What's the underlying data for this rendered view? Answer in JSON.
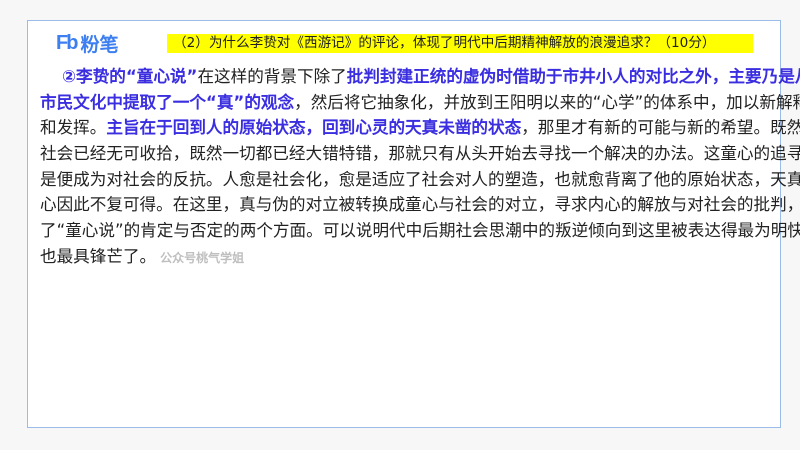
{
  "logo": {
    "mark": "Fb",
    "text": "粉笔"
  },
  "question": "（2）为什么李贽对《西游记》的评论，体现了明代中后期精神解放的浪漫追求？（10分）",
  "lines": [
    [
      {
        "t": "②李贽的“童心说”",
        "h": true
      },
      {
        "t": "在这样的背景下除了",
        "h": false
      },
      {
        "t": "批判封建正统的虚伪时借助于市井小人的对比之外，主要乃是从",
        "h": true
      }
    ],
    [
      {
        "t": "市民文化中提取了一个“真”的观念",
        "h": true
      },
      {
        "t": "，然后将它抽象化，并放到王阳明以来的“心学”的体系中，加以新解释",
        "h": false
      }
    ],
    [
      {
        "t": "和发挥。",
        "h": false
      },
      {
        "t": "主旨在于回到人的原始状态，回到心灵的天真未凿的状态",
        "h": true
      },
      {
        "t": "，那里才有新的可能与新的希望。既然这个",
        "h": false
      }
    ],
    [
      {
        "t": "社会已经无可收拾，既然一切都已经大错特错，那就只有从头开始去寻找一个解决的办法。这童心的追寻，于",
        "h": false
      }
    ],
    [
      {
        "t": "是便成为对社会的反抗。人愈是社会化，愈是适应了社会对人的塑造，也就愈背离了他的原始状态，天真的童",
        "h": false
      }
    ],
    [
      {
        "t": "心因此不复可得。在这里，真与伪的对立被转换成童心与社会的对立，寻求内心的解放与对社会的批判，构成",
        "h": false
      }
    ],
    [
      {
        "t": "了“童心说”的肯定与否定的两个方面。可以说明代中后期社会思潮中的叛逆倾向到这里被表达得最为明快，",
        "h": false
      }
    ],
    [
      {
        "t": "也最具锋芒了。",
        "h": false
      }
    ]
  ],
  "watermark": "公众号桃气学姐",
  "colors": {
    "highlight_text": "#3a2ee0",
    "question_bg": "#ffff00",
    "brand": "#3d7ff0"
  }
}
